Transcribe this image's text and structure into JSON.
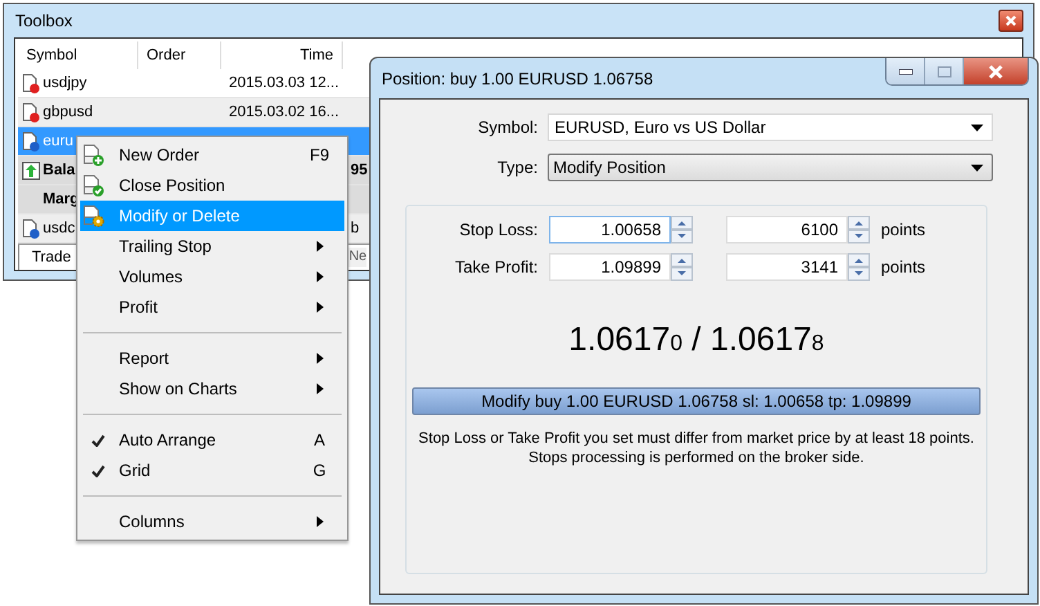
{
  "toolbox": {
    "title": "Toolbox",
    "columns": [
      "Symbol",
      "Order",
      "Time"
    ],
    "rows": [
      {
        "kind": "position",
        "symbol": "usdjpy",
        "color": "#e02020",
        "time": "2015.03.03 12...",
        "selected": false
      },
      {
        "kind": "position",
        "symbol": "gbpusd",
        "color": "#e02020",
        "time": "2015.03.02 16...",
        "selected": false
      },
      {
        "kind": "position",
        "symbol": "euru",
        "color": "#1f5fc8",
        "selected": true
      },
      {
        "kind": "balance",
        "symbol": "Bala",
        "value": "95",
        "selected": false
      },
      {
        "kind": "summary",
        "symbol": "Marg",
        "selected": false
      },
      {
        "kind": "position",
        "symbol": "usdc",
        "color": "#1f5fc8",
        "type": "b",
        "selected": false
      }
    ],
    "tabs": [
      {
        "label": "Trade",
        "selected": true
      },
      {
        "label": "Ne",
        "selected": false
      }
    ]
  },
  "context_menu": [
    {
      "kind": "action",
      "label": "New Order",
      "shortcut": "F9",
      "submenu": false,
      "checked": false,
      "selected": false
    },
    {
      "kind": "action",
      "label": "Close Position",
      "submenu": false,
      "checked": false,
      "selected": false
    },
    {
      "kind": "action",
      "label": "Modify or Delete",
      "submenu": false,
      "checked": false,
      "selected": true
    },
    {
      "kind": "item",
      "label": "Trailing Stop",
      "submenu": true,
      "checked": false,
      "selected": false
    },
    {
      "kind": "item",
      "label": "Volumes",
      "submenu": true,
      "checked": false,
      "selected": false
    },
    {
      "kind": "item",
      "label": "Profit",
      "submenu": true,
      "checked": false,
      "selected": false
    },
    {
      "kind": "separator"
    },
    {
      "kind": "item",
      "label": "Report",
      "submenu": true,
      "checked": false,
      "selected": false
    },
    {
      "kind": "item",
      "label": "Show on Charts",
      "submenu": true,
      "checked": false,
      "selected": false
    },
    {
      "kind": "separator"
    },
    {
      "kind": "item",
      "label": "Auto Arrange",
      "shortcut": "A",
      "submenu": false,
      "checked": true,
      "selected": false
    },
    {
      "kind": "item",
      "label": "Grid",
      "shortcut": "G",
      "submenu": false,
      "checked": true,
      "selected": false
    },
    {
      "kind": "separator"
    },
    {
      "kind": "item",
      "label": "Columns",
      "submenu": true,
      "checked": false,
      "selected": false
    }
  ],
  "dialog": {
    "title": "Position: buy 1.00 EURUSD 1.06758",
    "symbol": {
      "label": "Symbol:",
      "value": "EURUSD, Euro vs US Dollar"
    },
    "type": {
      "label": "Type:",
      "value": "Modify Position"
    },
    "levels": [
      {
        "label": "Stop Loss:",
        "price": "1.00658",
        "points": "6100",
        "unit": "points",
        "focused": true
      },
      {
        "label": "Take Profit:",
        "price": "1.09899",
        "points": "3141",
        "unit": "points",
        "focused": false
      }
    ],
    "quote": {
      "bid": "1.0617",
      "bid_tail": "0",
      "separator": "/",
      "ask": "1.0617",
      "ask_tail": "8"
    },
    "button": "Modify buy 1.00 EURUSD 1.06758 sl: 1.00658 tp: 1.09899",
    "note": [
      "Stop Loss or Take Profit you set must differ from market price by at least 18 points.",
      "Stops processing is performed on the broker side."
    ]
  }
}
